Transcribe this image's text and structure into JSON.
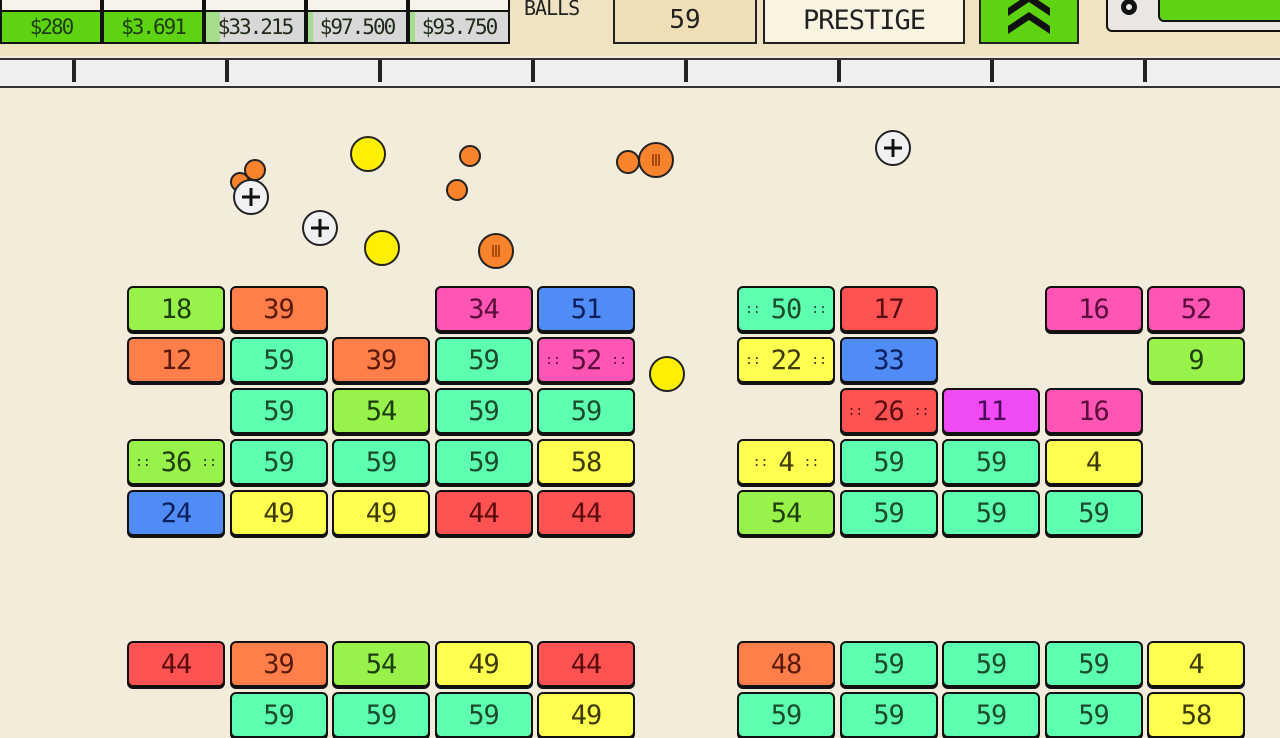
{
  "header": {
    "upgrades": [
      {
        "price": "$280",
        "affordable": true,
        "progress": 1.0
      },
      {
        "price": "$3.691",
        "affordable": true,
        "progress": 1.0
      },
      {
        "price": "$33.215",
        "affordable": false,
        "progress": 0.14
      },
      {
        "price": "$97.500",
        "affordable": false,
        "progress": 0.05
      },
      {
        "price": "$93.750",
        "affordable": false,
        "progress": 0.05
      }
    ],
    "balls_label": "BALLS",
    "balls_count": "59",
    "prestige_label": "PRESTIGE",
    "upgrade_icon": "double-chevron-up-icon",
    "settings_icon": "gear-icon"
  },
  "colors": {
    "background": "#f3ecda",
    "affordable_green": "#5ed312",
    "teal": "#5dffb0",
    "lime": "#98f24a",
    "orange": "#ff7e4a",
    "pink": "#ff55b4",
    "blue": "#4f8cf5",
    "red": "#ff5252",
    "yellow": "#ffff50",
    "magenta": "#f04af5"
  },
  "bricks": [
    {
      "v": "18",
      "c": "lime",
      "col": 0,
      "row": 0,
      "g": 0
    },
    {
      "v": "39",
      "c": "orange",
      "col": 1,
      "row": 0,
      "g": 0
    },
    {
      "v": "34",
      "c": "pink",
      "col": 3,
      "row": 0,
      "g": 0
    },
    {
      "v": "51",
      "c": "blue",
      "col": 4,
      "row": 0,
      "g": 0
    },
    {
      "v": "12",
      "c": "orange",
      "col": 0,
      "row": 1,
      "g": 0
    },
    {
      "v": "59",
      "c": "teal",
      "col": 1,
      "row": 1,
      "g": 0
    },
    {
      "v": "39",
      "c": "orange",
      "col": 2,
      "row": 1,
      "g": 0
    },
    {
      "v": "59",
      "c": "teal",
      "col": 3,
      "row": 1,
      "g": 0
    },
    {
      "v": "52",
      "c": "pink",
      "col": 4,
      "row": 1,
      "g": 0,
      "special": true
    },
    {
      "v": "59",
      "c": "teal",
      "col": 1,
      "row": 2,
      "g": 0
    },
    {
      "v": "54",
      "c": "lime",
      "col": 2,
      "row": 2,
      "g": 0
    },
    {
      "v": "59",
      "c": "teal",
      "col": 3,
      "row": 2,
      "g": 0
    },
    {
      "v": "59",
      "c": "teal",
      "col": 4,
      "row": 2,
      "g": 0
    },
    {
      "v": "36",
      "c": "lime",
      "col": 0,
      "row": 3,
      "g": 0,
      "special": true
    },
    {
      "v": "59",
      "c": "teal",
      "col": 1,
      "row": 3,
      "g": 0
    },
    {
      "v": "59",
      "c": "teal",
      "col": 2,
      "row": 3,
      "g": 0
    },
    {
      "v": "59",
      "c": "teal",
      "col": 3,
      "row": 3,
      "g": 0
    },
    {
      "v": "58",
      "c": "yellow",
      "col": 4,
      "row": 3,
      "g": 0
    },
    {
      "v": "24",
      "c": "blue",
      "col": 0,
      "row": 4,
      "g": 0
    },
    {
      "v": "49",
      "c": "yellow",
      "col": 1,
      "row": 4,
      "g": 0
    },
    {
      "v": "49",
      "c": "yellow",
      "col": 2,
      "row": 4,
      "g": 0
    },
    {
      "v": "44",
      "c": "red",
      "col": 3,
      "row": 4,
      "g": 0
    },
    {
      "v": "44",
      "c": "red",
      "col": 4,
      "row": 4,
      "g": 0
    },
    {
      "v": "50",
      "c": "teal",
      "col": 0,
      "row": 0,
      "g": 1,
      "special": true
    },
    {
      "v": "17",
      "c": "red",
      "col": 1,
      "row": 0,
      "g": 1
    },
    {
      "v": "16",
      "c": "pink",
      "col": 3,
      "row": 0,
      "g": 1
    },
    {
      "v": "52",
      "c": "pink",
      "col": 4,
      "row": 0,
      "g": 1
    },
    {
      "v": "22",
      "c": "yellow",
      "col": 0,
      "row": 1,
      "g": 1,
      "special": true
    },
    {
      "v": "33",
      "c": "blue",
      "col": 1,
      "row": 1,
      "g": 1
    },
    {
      "v": "9",
      "c": "lime",
      "col": 4,
      "row": 1,
      "g": 1
    },
    {
      "v": "26",
      "c": "red",
      "col": 1,
      "row": 2,
      "g": 1,
      "special": true
    },
    {
      "v": "11",
      "c": "magenta",
      "col": 2,
      "row": 2,
      "g": 1
    },
    {
      "v": "16",
      "c": "pink",
      "col": 3,
      "row": 2,
      "g": 1
    },
    {
      "v": "4",
      "c": "yellow",
      "col": 0,
      "row": 3,
      "g": 1,
      "special": true
    },
    {
      "v": "59",
      "c": "teal",
      "col": 1,
      "row": 3,
      "g": 1
    },
    {
      "v": "59",
      "c": "teal",
      "col": 2,
      "row": 3,
      "g": 1
    },
    {
      "v": "4",
      "c": "yellow",
      "col": 3,
      "row": 3,
      "g": 1
    },
    {
      "v": "54",
      "c": "lime",
      "col": 0,
      "row": 4,
      "g": 1
    },
    {
      "v": "59",
      "c": "teal",
      "col": 1,
      "row": 4,
      "g": 1
    },
    {
      "v": "59",
      "c": "teal",
      "col": 2,
      "row": 4,
      "g": 1
    },
    {
      "v": "59",
      "c": "teal",
      "col": 3,
      "row": 4,
      "g": 1
    },
    {
      "v": "44",
      "c": "red",
      "col": 0,
      "row": 0,
      "g": 2
    },
    {
      "v": "39",
      "c": "orange",
      "col": 1,
      "row": 0,
      "g": 2
    },
    {
      "v": "54",
      "c": "lime",
      "col": 2,
      "row": 0,
      "g": 2
    },
    {
      "v": "49",
      "c": "yellow",
      "col": 3,
      "row": 0,
      "g": 2
    },
    {
      "v": "44",
      "c": "red",
      "col": 4,
      "row": 0,
      "g": 2
    },
    {
      "v": "59",
      "c": "teal",
      "col": 1,
      "row": 1,
      "g": 2
    },
    {
      "v": "59",
      "c": "teal",
      "col": 2,
      "row": 1,
      "g": 2
    },
    {
      "v": "59",
      "c": "teal",
      "col": 3,
      "row": 1,
      "g": 2
    },
    {
      "v": "49",
      "c": "yellow",
      "col": 4,
      "row": 1,
      "g": 2
    },
    {
      "v": "48",
      "c": "orange",
      "col": 0,
      "row": 0,
      "g": 3
    },
    {
      "v": "59",
      "c": "teal",
      "col": 1,
      "row": 0,
      "g": 3
    },
    {
      "v": "59",
      "c": "teal",
      "col": 2,
      "row": 0,
      "g": 3
    },
    {
      "v": "59",
      "c": "teal",
      "col": 3,
      "row": 0,
      "g": 3
    },
    {
      "v": "4",
      "c": "yellow",
      "col": 4,
      "row": 0,
      "g": 3
    },
    {
      "v": "59",
      "c": "teal",
      "col": 0,
      "row": 1,
      "g": 3
    },
    {
      "v": "59",
      "c": "teal",
      "col": 1,
      "row": 1,
      "g": 3
    },
    {
      "v": "59",
      "c": "teal",
      "col": 2,
      "row": 1,
      "g": 3
    },
    {
      "v": "59",
      "c": "teal",
      "col": 3,
      "row": 1,
      "g": 3
    },
    {
      "v": "58",
      "c": "yellow",
      "col": 4,
      "row": 1,
      "g": 3
    }
  ],
  "balls": [
    {
      "type": "yellow",
      "name": "basic-ball"
    },
    {
      "type": "yellow",
      "name": "basic-ball"
    },
    {
      "type": "yellow",
      "name": "basic-ball"
    },
    {
      "type": "orange",
      "name": "small-ball"
    },
    {
      "type": "orange",
      "name": "small-ball"
    },
    {
      "type": "orange",
      "name": "small-ball"
    },
    {
      "type": "orange",
      "name": "small-ball"
    },
    {
      "type": "orange",
      "name": "small-ball"
    },
    {
      "type": "orange-bars",
      "name": "striped-ball"
    },
    {
      "type": "orange-bars",
      "name": "striped-ball"
    },
    {
      "type": "plus",
      "name": "plus-ball"
    },
    {
      "type": "plus",
      "name": "plus-ball"
    },
    {
      "type": "plus",
      "name": "plus-ball"
    }
  ]
}
